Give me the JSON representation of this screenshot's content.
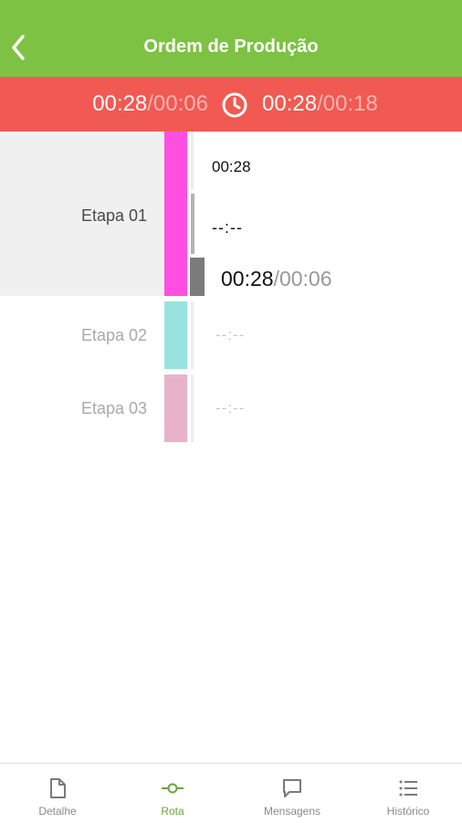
{
  "header": {
    "title": "Ordem de Produção"
  },
  "timer_bar": {
    "left_elapsed": "00:28",
    "left_total": "/00:06",
    "right_elapsed": "00:28",
    "right_total": "/00:18"
  },
  "stages": [
    {
      "label": "Etapa 01",
      "color": "#ff4fe0",
      "time_top": "00:28",
      "time_mid": "--:--",
      "time_elapsed": "00:28",
      "time_total": "/00:06"
    },
    {
      "label": "Etapa 02",
      "color": "#98e3dd",
      "time": "--:--"
    },
    {
      "label": "Etapa 03",
      "color": "#e8b2cb",
      "time": "--:--"
    }
  ],
  "tabs": [
    {
      "label": "Detalhe",
      "icon": "document-icon"
    },
    {
      "label": "Rota",
      "icon": "route-icon"
    },
    {
      "label": "Mensagens",
      "icon": "chat-bubble-icon"
    },
    {
      "label": "Histórico",
      "icon": "list-icon"
    }
  ],
  "colors": {
    "header_green": "#7dc242",
    "timer_red": "#f05a52",
    "active_tab_green": "#6aa63a"
  }
}
